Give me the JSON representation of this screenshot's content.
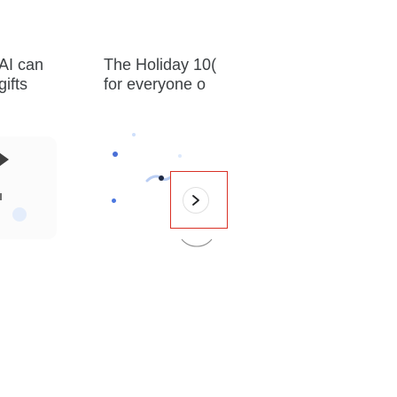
{
  "cards": [
    {
      "title_line1": "AI can",
      "title_line2": "gifts"
    },
    {
      "title_line1": "The Holiday 10(",
      "title_line2": "for everyone o"
    }
  ],
  "carousel": {
    "prev_icon": "chevron-right-icon",
    "next_icon": "chevron-right-icon",
    "highlight_color": "#d93025",
    "accent_color": "#4285f4"
  }
}
